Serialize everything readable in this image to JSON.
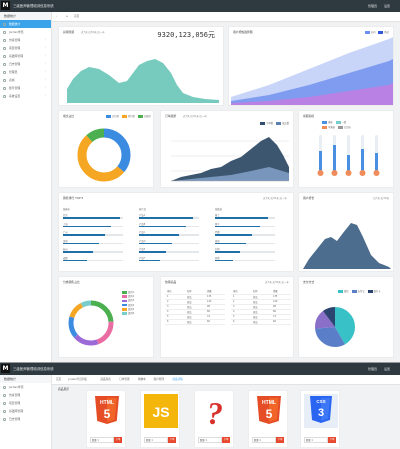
{
  "app": {
    "logo": "M",
    "title": "三级医师管理培训信息系统",
    "user": "管理员",
    "menu": "设置"
  },
  "sidebar": {
    "header": "数据统计",
    "items": [
      {
        "label": "数据统计"
      },
      {
        "label": "Jordan学员"
      },
      {
        "label": "仿真管理"
      },
      {
        "label": "项目管理"
      },
      {
        "label": "基础库管理"
      },
      {
        "label": "日志管理"
      },
      {
        "label": "管理员"
      },
      {
        "label": "商城"
      },
      {
        "label": "账号管理"
      },
      {
        "label": "系统设置"
      }
    ]
  },
  "screen1": {
    "tabs": [
      "首页"
    ],
    "revenue": {
      "title": "总销售额",
      "filters": "近7天  近30天  近一年",
      "value": "9320,123,056元"
    },
    "users": {
      "title": "用户增幅趋势图",
      "legend": [
        "访问",
        "购买"
      ]
    },
    "pie1": {
      "title": "成交占比",
      "legend": [
        "已付款",
        "待付款",
        "已取消"
      ]
    },
    "area2": {
      "title": "订单趋势",
      "filters": "近7天  近30天  近一年",
      "legend": [
        "下单数",
        "成交数"
      ]
    },
    "thermo": {
      "title": "客服指标",
      "legend": [
        "满意",
        "一般",
        "不满意",
        "已回访"
      ]
    },
    "ranks": {
      "title": "销售排行 TOP 5",
      "filters": "近7天  近30天  近一年",
      "cols": [
        {
          "head": "按城市",
          "rows": [
            "北京",
            "上海",
            "广州",
            "深圳",
            "杭州",
            "成都"
          ]
        },
        {
          "head": "按产品",
          "rows": [
            "产品A",
            "产品B",
            "产品C",
            "产品D",
            "产品E",
            "产品F"
          ]
        },
        {
          "head": "按渠道",
          "rows": [
            "线上",
            "线下",
            "代理",
            "直营",
            "分销",
            "其他"
          ]
        }
      ]
    },
    "mountain": {
      "title": "用户增长",
      "filters": "近7天  近30天"
    },
    "donut2": {
      "title": "分类销售占比",
      "legend": [
        "类别1",
        "类别2",
        "类别3",
        "类别4",
        "类别5",
        "类别6"
      ]
    },
    "tables": {
      "title": "热销商品",
      "filters": "近7天  近30天  近一年",
      "head": [
        "排名",
        "名称",
        "销量"
      ],
      "rows": [
        [
          "1",
          "商品",
          "135"
        ],
        [
          "2",
          "商品",
          "120"
        ],
        [
          "3",
          "商品",
          "98"
        ],
        [
          "4",
          "商品",
          "86"
        ],
        [
          "5",
          "商品",
          "74"
        ],
        [
          "6",
          "商品",
          "60"
        ]
      ]
    },
    "pie3": {
      "title": "支付方式",
      "legend": [
        "微信",
        "支付宝",
        "银行卡",
        "其他"
      ]
    }
  },
  "screen2": {
    "tabs": [
      "首页",
      "Jordan学员列表",
      "商品列表",
      "订单管理",
      "购物车",
      "账户管理",
      "商品详情"
    ],
    "section": "商品展示",
    "products": [
      {
        "icon": "html5-icon",
        "qty_label": "数量",
        "qty": "1",
        "buy": "下单"
      },
      {
        "icon": "javascript-icon",
        "qty_label": "数量",
        "qty": "1",
        "buy": "下单"
      },
      {
        "icon": "question-icon",
        "qty_label": "数量",
        "qty": "1",
        "buy": "下单"
      },
      {
        "icon": "html5-icon",
        "qty_label": "数量",
        "qty": "1",
        "buy": "下单"
      },
      {
        "icon": "css3-icon",
        "qty_label": "数量",
        "qty": "1",
        "buy": "下单"
      }
    ],
    "colors": {
      "html5": "#e44d26",
      "js": "#f5b60c",
      "css3": "#2965f1"
    }
  }
}
